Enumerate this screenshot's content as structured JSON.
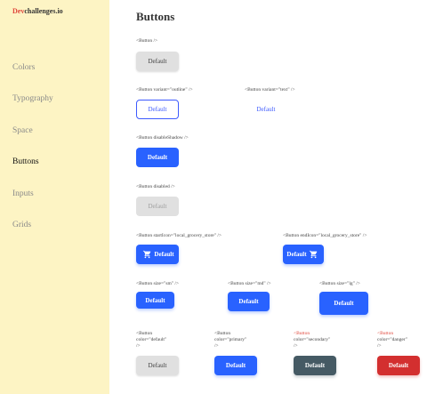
{
  "brand": {
    "accent": "Dev",
    "rest": "challenges.io"
  },
  "sidebar": {
    "items": [
      {
        "label": "Colors"
      },
      {
        "label": "Typography"
      },
      {
        "label": "Space"
      },
      {
        "label": "Buttons"
      },
      {
        "label": "Inputs"
      },
      {
        "label": "Grids"
      }
    ]
  },
  "page": {
    "title": "Buttons"
  },
  "examples": {
    "basic": {
      "code": "<Button />",
      "label": "Default"
    },
    "outline": {
      "code": "<Button variant=\"outline\" />",
      "label": "Default"
    },
    "text": {
      "code": "<Button variant=\"text\" />",
      "label": "Default"
    },
    "no_shadow": {
      "code": "<Button disableShadow />",
      "label": "Default"
    },
    "disabled": {
      "code": "<Button disabled />",
      "label": "Default"
    },
    "start_icon": {
      "code": "<Button startIcon=\"local_grocery_store\" />",
      "label": "Default"
    },
    "end_icon": {
      "code": "<Button endIcon=\"local_grocery_store\" />",
      "label": "Default"
    },
    "size_sm": {
      "code": "<Button size=\"sm\" />",
      "label": "Default"
    },
    "size_md": {
      "code": "<Button size=\"md\" />",
      "label": "Default"
    },
    "size_lg": {
      "code": "<Button size=\"lg\" />",
      "label": "Default"
    },
    "color_default": {
      "code_a": "<Button",
      "code_b": "color=\"default\"",
      "code_c": "/>",
      "label": "Default"
    },
    "color_primary": {
      "code_a": "<Button",
      "code_b": "color=\"primary\"",
      "code_c": "/>",
      "label": "Default"
    },
    "color_secondary": {
      "code_a": "<Button",
      "code_b": "color=\"secondary\"",
      "code_c": "/>",
      "label": "Default"
    },
    "color_danger": {
      "code_a": "<Button",
      "code_b": "color=\"danger\"",
      "code_c": "/>",
      "label": "Default"
    }
  },
  "icons": {
    "cart": "local-grocery-store-icon"
  },
  "colors": {
    "sidebar_bg": "#fdf4c4",
    "primary": "#2962ff",
    "secondary": "#455a64",
    "danger": "#d32f2f",
    "default": "#e0e0e0",
    "brand_accent": "#e0473c"
  }
}
